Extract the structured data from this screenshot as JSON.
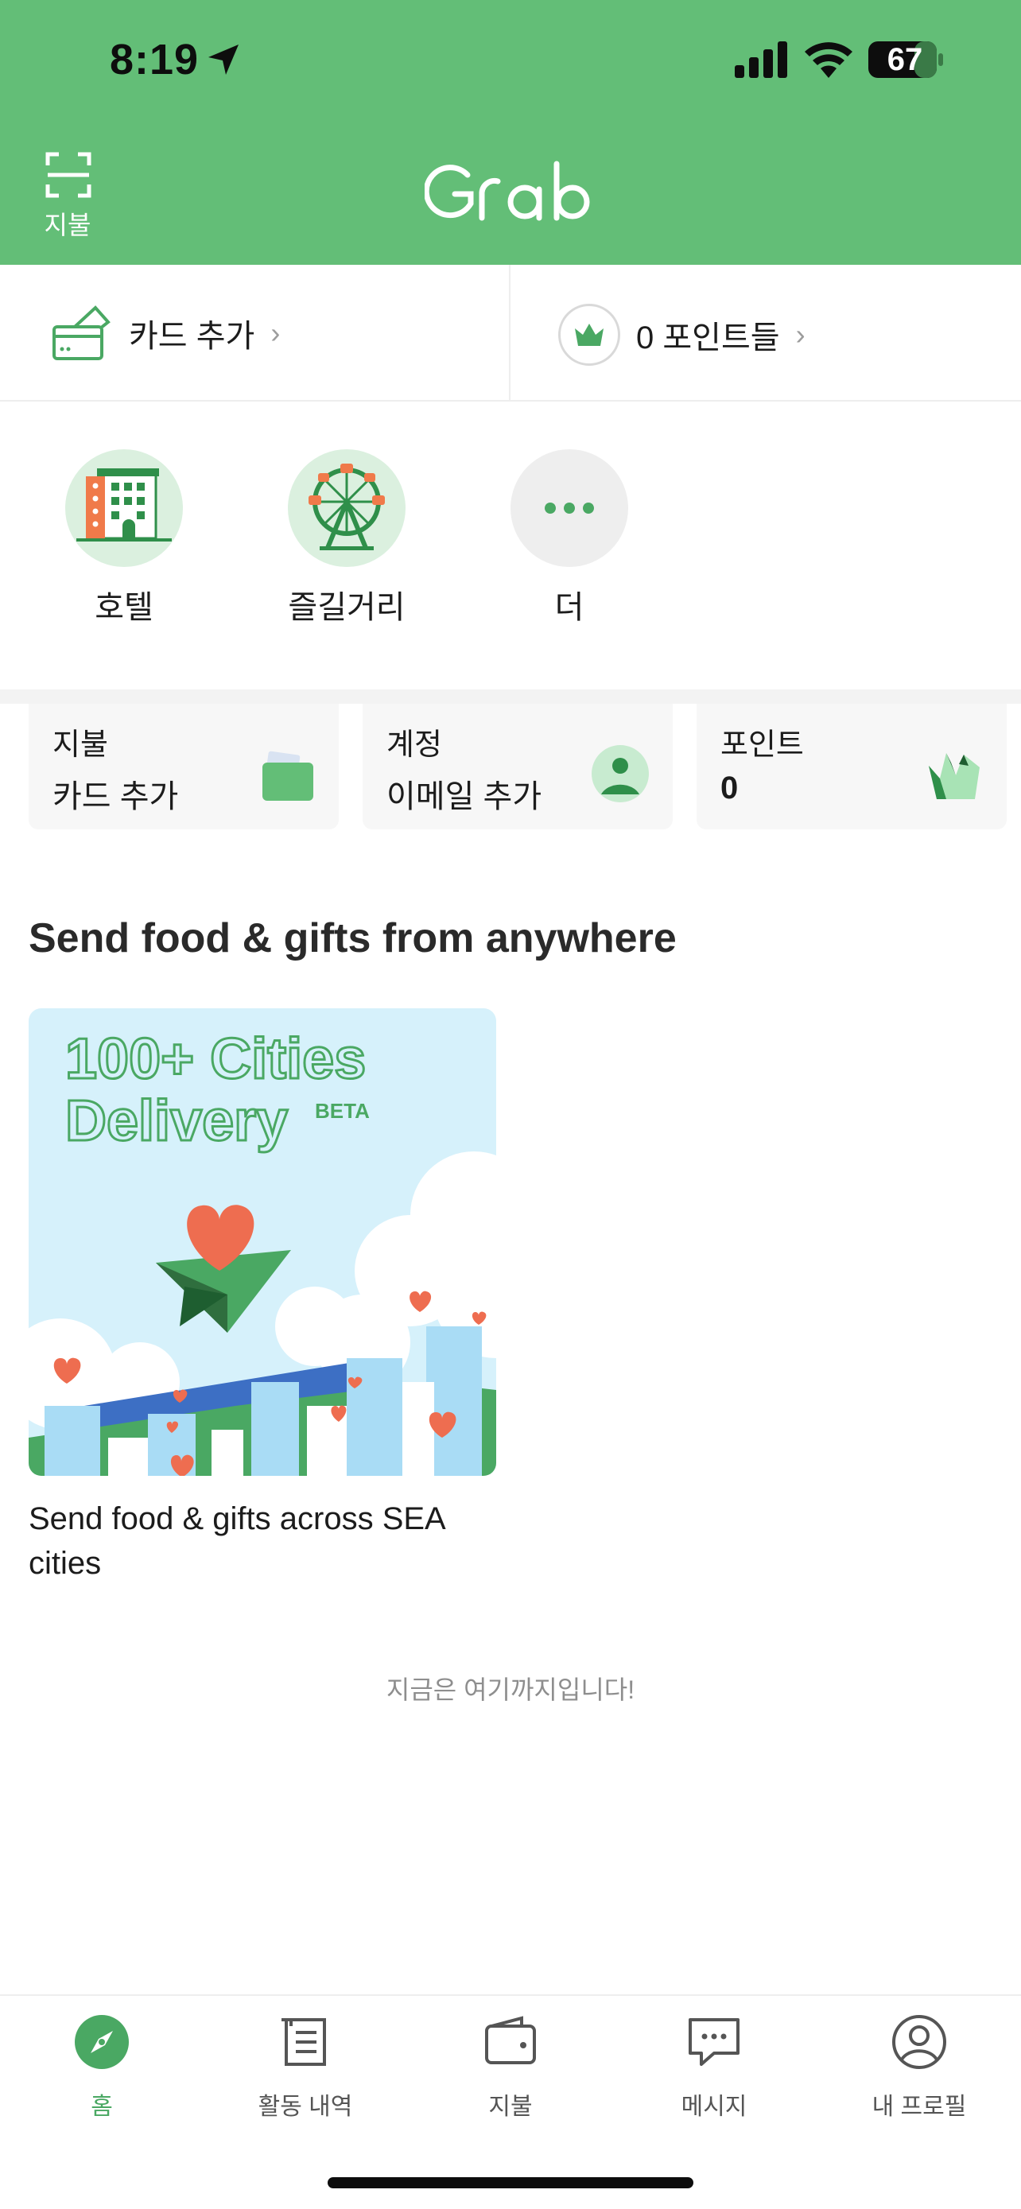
{
  "status_bar": {
    "time": "8:19",
    "battery": "67"
  },
  "header": {
    "scan_label": "지불",
    "logo_text": "Grab"
  },
  "quick_row": {
    "add_card": "카드 추가",
    "points": "0 포인트들"
  },
  "services": [
    {
      "label": "호텔"
    },
    {
      "label": "즐길거리"
    },
    {
      "label": "더"
    }
  ],
  "tiles": [
    {
      "title": "지불",
      "value": "카드 추가"
    },
    {
      "title": "계정",
      "value": "이메일 추가"
    },
    {
      "title": "포인트",
      "value": "0"
    }
  ],
  "section": {
    "title": "Send food & gifts from anywhere",
    "promo_line1": "100+ Cities",
    "promo_line2": "Delivery",
    "promo_badge": "BETA",
    "caption": "Send food & gifts across SEA cities"
  },
  "end_text": "지금은 여기까지입니다!",
  "bottom_nav": [
    {
      "label": "홈",
      "icon": "compass-icon",
      "active": true
    },
    {
      "label": "활동 내역",
      "icon": "receipt-icon",
      "active": false
    },
    {
      "label": "지불",
      "icon": "wallet-icon",
      "active": false
    },
    {
      "label": "메시지",
      "icon": "chat-icon",
      "active": false
    },
    {
      "label": "내 프로필",
      "icon": "profile-icon",
      "active": false
    }
  ],
  "colors": {
    "brand_green": "#63be77",
    "accent_green": "#4aa863",
    "promo_bg": "#d6f1fb"
  }
}
